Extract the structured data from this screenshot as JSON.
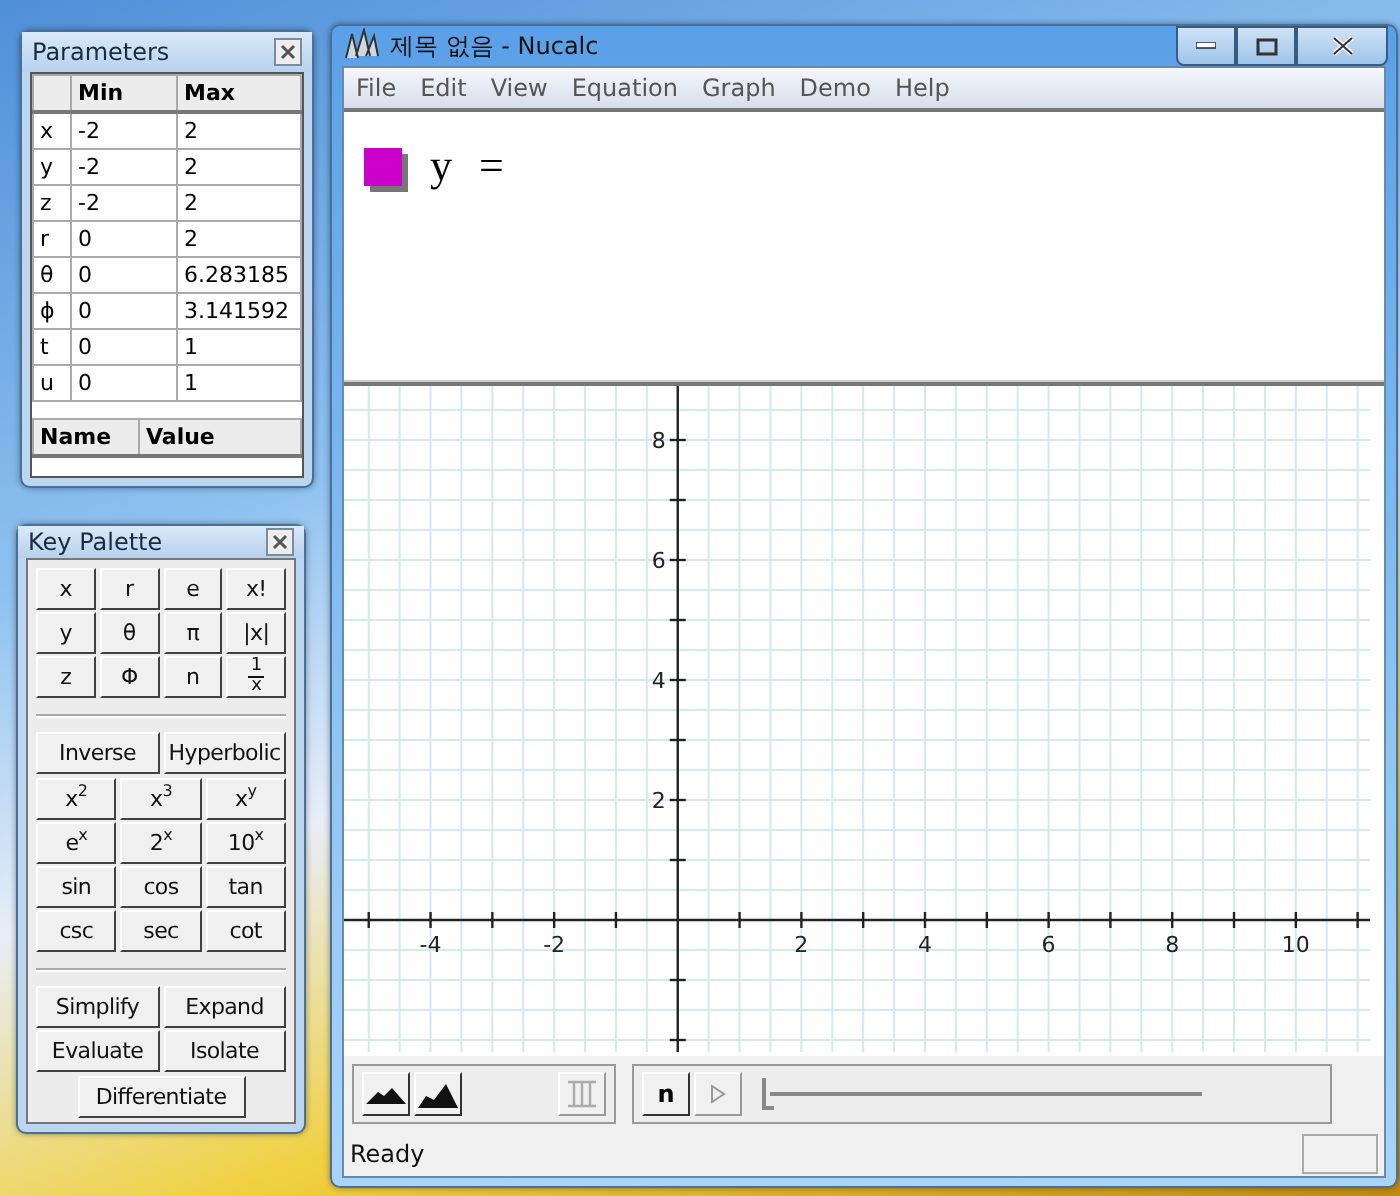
{
  "parameters_window": {
    "title": "Parameters",
    "range_table": {
      "columns": [
        "Min",
        "Max"
      ],
      "rows": [
        {
          "name": "x",
          "min": "-2",
          "max": "2"
        },
        {
          "name": "y",
          "min": "-2",
          "max": "2"
        },
        {
          "name": "z",
          "min": "-2",
          "max": "2"
        },
        {
          "name": "r",
          "min": "0",
          "max": "2"
        },
        {
          "name": "θ",
          "min": "0",
          "max": "6.283185"
        },
        {
          "name": "ϕ",
          "min": "0",
          "max": "3.141592"
        },
        {
          "name": "t",
          "min": "0",
          "max": "1"
        },
        {
          "name": "u",
          "min": "0",
          "max": "1"
        }
      ]
    },
    "value_table": {
      "columns": [
        "Name",
        "Value"
      ]
    }
  },
  "key_palette": {
    "title": "Key Palette",
    "groups": [
      {
        "kind": "symbols",
        "keys": [
          {
            "kind": "text",
            "label": "x"
          },
          {
            "kind": "text",
            "label": "r"
          },
          {
            "kind": "text",
            "label": "e"
          },
          {
            "kind": "text",
            "label": "x!"
          },
          {
            "kind": "text",
            "label": "y"
          },
          {
            "kind": "text",
            "label": "θ"
          },
          {
            "kind": "text",
            "label": "π"
          },
          {
            "kind": "text",
            "label": "|x|"
          },
          {
            "kind": "text",
            "label": "z"
          },
          {
            "kind": "text",
            "label": "Φ"
          },
          {
            "kind": "text",
            "label": "n"
          },
          {
            "kind": "fraction",
            "numerator": "1",
            "denominator": "x"
          }
        ]
      },
      {
        "kind": "modifiers",
        "keys": [
          {
            "kind": "text",
            "label": "Inverse"
          },
          {
            "kind": "text",
            "label": "Hyperbolic"
          }
        ]
      },
      {
        "kind": "functions",
        "keys": [
          {
            "kind": "text",
            "label": "x$^{2}$"
          },
          {
            "kind": "text",
            "label": "x$^{3}$"
          },
          {
            "kind": "text",
            "label": "x$^{y}$"
          },
          {
            "kind": "text",
            "label": "e$^{x}$"
          },
          {
            "kind": "text",
            "label": "2$^{x}$"
          },
          {
            "kind": "text",
            "label": "10$^{x}$"
          },
          {
            "kind": "text",
            "label": "sin"
          },
          {
            "kind": "text",
            "label": "cos"
          },
          {
            "kind": "text",
            "label": "tan"
          },
          {
            "kind": "text",
            "label": "csc"
          },
          {
            "kind": "text",
            "label": "sec"
          },
          {
            "kind": "text",
            "label": "cot"
          }
        ]
      },
      {
        "kind": "commands",
        "keys": [
          {
            "kind": "text",
            "label": "Simplify"
          },
          {
            "kind": "text",
            "label": "Expand"
          },
          {
            "kind": "text",
            "label": "Evaluate"
          },
          {
            "kind": "text",
            "label": "Isolate"
          }
        ]
      },
      {
        "kind": "wide",
        "keys": [
          {
            "kind": "text",
            "label": "Differentiate"
          }
        ]
      }
    ]
  },
  "main_window": {
    "title": "제목 없음 - Nucalc",
    "menu": [
      "File",
      "Edit",
      "View",
      "Equation",
      "Graph",
      "Demo",
      "Help"
    ],
    "equation": {
      "color": "#cc00cc",
      "text": "y ="
    },
    "graph": {
      "chart_data": {
        "type": "line",
        "grid": true,
        "xlim": [
          -5.4,
          11.2
        ],
        "ylim": [
          -2.2,
          8.9
        ],
        "xticks": [
          -4,
          -2,
          2,
          4,
          6,
          8,
          10
        ],
        "yticks": [
          2,
          4,
          6,
          8
        ]
      }
    },
    "toolbar": {
      "n_button": "n",
      "play_disabled": true,
      "slider": {
        "level": 0
      }
    },
    "status_bar": "Ready"
  }
}
